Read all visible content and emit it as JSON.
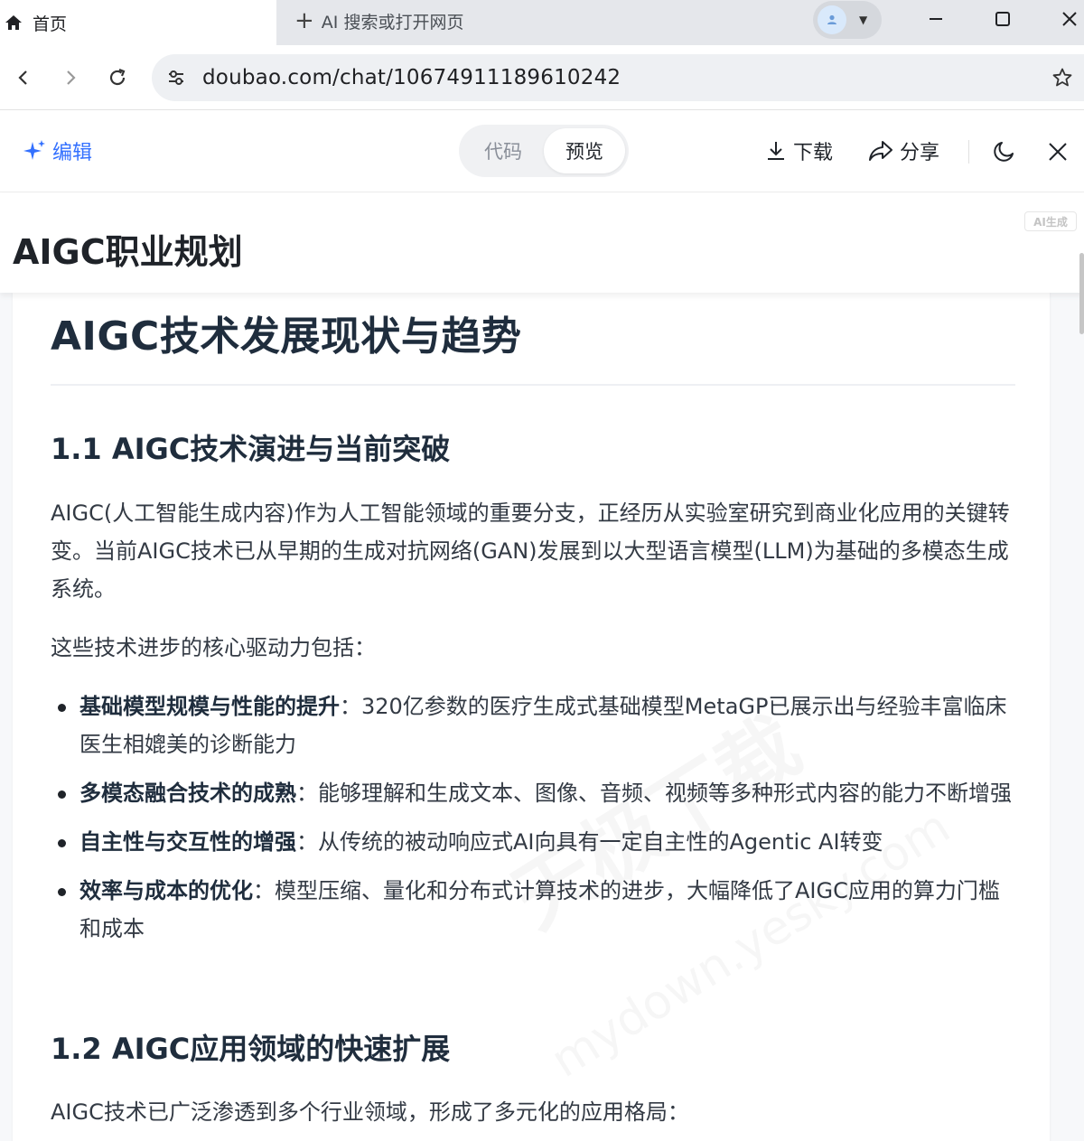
{
  "browser": {
    "active_tab": {
      "label": "首页",
      "icon": "home-icon"
    },
    "new_tab": {
      "label": "AI 搜索或打开网页",
      "icon": "plus-icon"
    },
    "address": {
      "url": "doubao.com/chat/10674911189610242"
    }
  },
  "toolbar": {
    "edit_label": "编辑",
    "view_modes": [
      "代码",
      "预览"
    ],
    "active_view": "预览",
    "download_label": "下载",
    "share_label": "分享",
    "accent_color": "#3370ff"
  },
  "doc": {
    "title": "AIGC职业规划",
    "ai_badge": "AI生成"
  },
  "content": {
    "h1": "AIGC技术发展现状与趋势",
    "s1": {
      "heading": "1.1 AIGC技术演进与当前突破",
      "intro": "AIGC(人工智能生成内容)作为人工智能领域的重要分支，正经历从实验室研究到商业化应用的关键转变。当前AIGC技术已从早期的生成对抗网络(GAN)发展到以大型语言模型(LLM)为基础的多模态生成系统。",
      "lead": "这些技术进步的核心驱动力包括：",
      "bullets": [
        {
          "term": "基础模型规模与性能的提升",
          "text": "：320亿参数的医疗生成式基础模型MetaGP已展示出与经验丰富临床医生相媲美的诊断能力"
        },
        {
          "term": "多模态融合技术的成熟",
          "text": "：能够理解和生成文本、图像、音频、视频等多种形式内容的能力不断增强"
        },
        {
          "term": "自主性与交互性的增强",
          "text": "：从传统的被动响应式AI向具有一定自主性的Agentic AI转变"
        },
        {
          "term": "效率与成本的优化",
          "text": "：模型压缩、量化和分布式计算技术的进步，大幅降低了AIGC应用的算力门槛和成本"
        }
      ]
    },
    "s2": {
      "heading": "1.2 AIGC应用领域的快速扩展",
      "intro": "AIGC技术已广泛渗透到多个行业领域，形成了多元化的应用格局："
    }
  },
  "watermark": {
    "line1": "天极下载",
    "line2": "mydown.yesky.com"
  }
}
